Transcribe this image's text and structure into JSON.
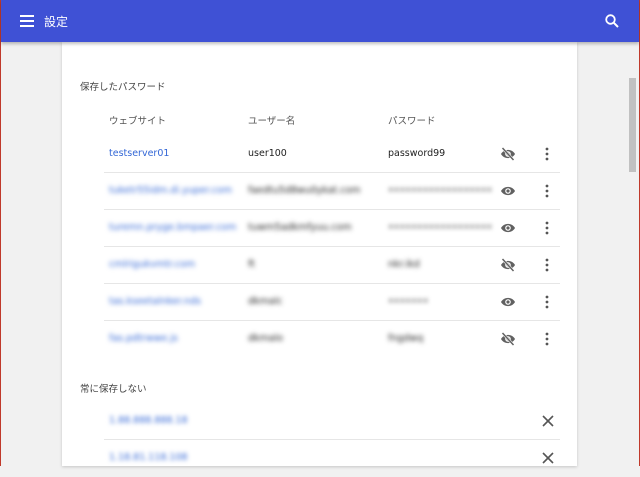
{
  "toolbar": {
    "title": "設定",
    "menu_icon": "menu-icon",
    "search_icon": "search-icon"
  },
  "saved_passwords": {
    "title": "保存したパスワード",
    "headers": {
      "site": "ウェブサイト",
      "user": "ユーザー名",
      "password": "パスワード"
    },
    "rows": [
      {
        "site": "testserver01",
        "user": "user100",
        "password": "password99",
        "revealed": true,
        "blurred": false,
        "eye_icon": "eye-off-icon"
      },
      {
        "site": "tuketr55idm.di.yuper.com",
        "user": "faedtu5d8wu0ykat.com",
        "password": "••••••••••••••••••",
        "revealed": false,
        "blurred": true,
        "eye_icon": "eye-icon"
      },
      {
        "site": "turemn.pryge.bmpaer.com",
        "user": "tuwm5adkmfyuu.com",
        "password": "••••••••••••••••••",
        "revealed": false,
        "blurred": true,
        "eye_icon": "eye-icon"
      },
      {
        "site": "cmlrigukvmtr.com",
        "user": "ft",
        "password": "nkr.ikd",
        "revealed": true,
        "blurred": true,
        "eye_icon": "eye-off-icon"
      },
      {
        "site": "tas.kseetalnker.nds",
        "user": "dkmalc",
        "password": "•••••••",
        "revealed": false,
        "blurred": true,
        "eye_icon": "eye-icon"
      },
      {
        "site": "fas.pdtrwwe.js",
        "user": "dkmalo",
        "password": "fngdwq",
        "revealed": true,
        "blurred": true,
        "eye_icon": "eye-off-icon"
      }
    ]
  },
  "never_saved": {
    "title": "常に保存しない",
    "rows": [
      {
        "site": "1.88.888.888.18"
      },
      {
        "site": "1.18.81.118.108"
      }
    ]
  },
  "colors": {
    "accent": "#3f51d5",
    "link": "#3367d6"
  }
}
